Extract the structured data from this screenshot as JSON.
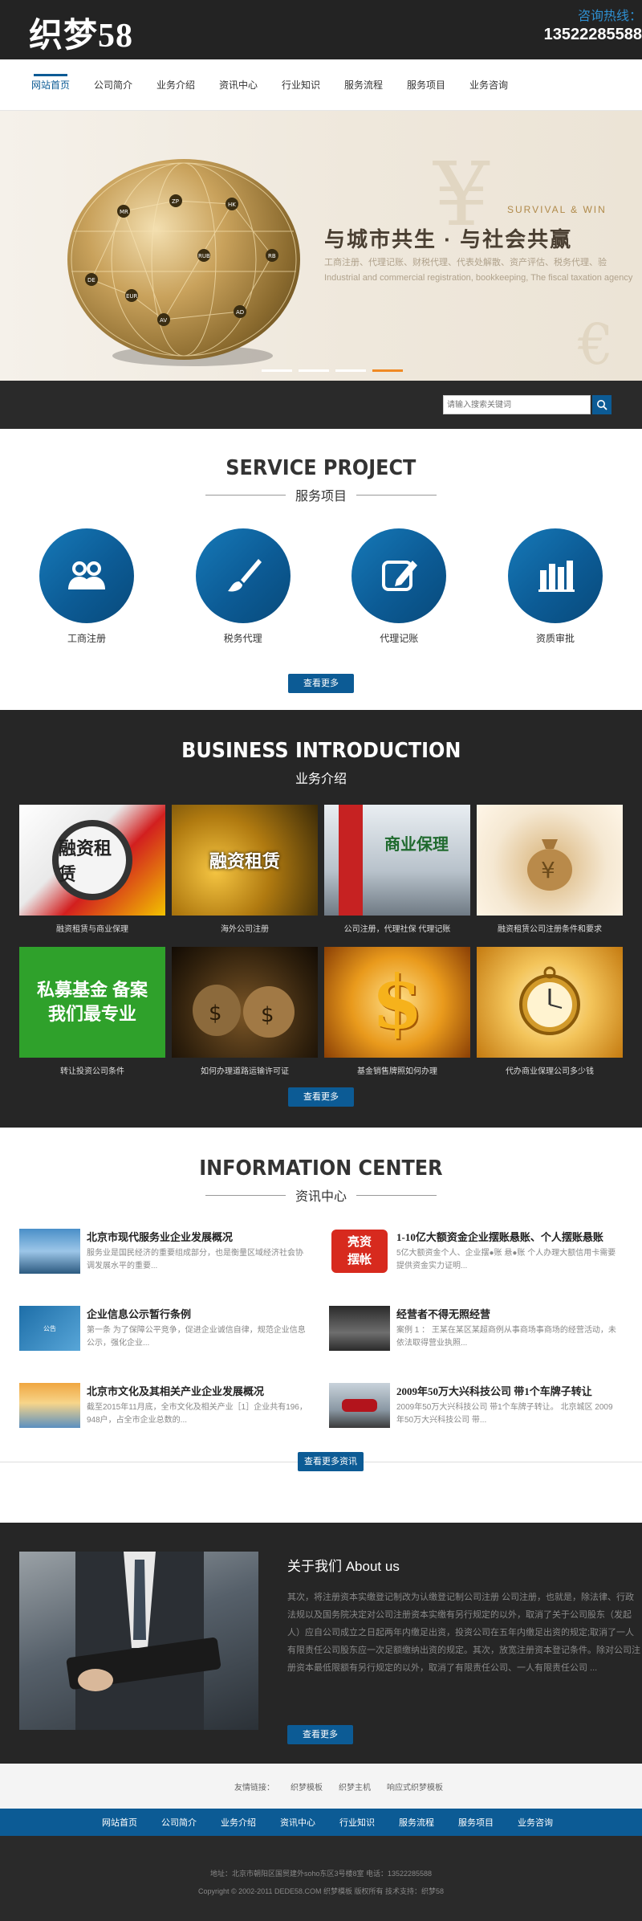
{
  "header": {
    "logo": "织梦58",
    "hotline_label": "咨询热线：",
    "hotline_number": "13522285588"
  },
  "nav": {
    "items": [
      "网站首页",
      "公司简介",
      "业务介绍",
      "资讯中心",
      "行业知识",
      "服务流程",
      "服务项目",
      "业务咨询"
    ]
  },
  "banner": {
    "tag": "SURVIVAL & WIN",
    "headline": "与城市共生 · 与社会共赢",
    "sub1": "工商注册、代理记账、财税代理、代表处解散、资产评估、税务代理、验",
    "sub2": "Industrial and commercial registration, bookkeeping, The fiscal taxation agency",
    "globe_labels": [
      "HK",
      "RB",
      "AD",
      "DE",
      "MR",
      "ZP",
      "AV",
      "EUR",
      "RUB"
    ]
  },
  "search": {
    "placeholder": "请输入搜索关键词"
  },
  "service": {
    "title_en": "SERVICE PROJECT",
    "title_cn": "服务项目",
    "items": [
      {
        "label": "工商注册",
        "icon": "people-icon"
      },
      {
        "label": "税务代理",
        "icon": "brush-icon"
      },
      {
        "label": "代理记账",
        "icon": "edit-icon"
      },
      {
        "label": "资质审批",
        "icon": "chart-icon"
      }
    ],
    "more": "查看更多"
  },
  "business": {
    "title_en": "BUSINESS INTRODUCTION",
    "title_cn": "业务介绍",
    "items": [
      {
        "caption": "融资租赁与商业保理",
        "img_text": "融资租赁"
      },
      {
        "caption": "海外公司注册",
        "img_text": "融资租赁"
      },
      {
        "caption": "公司注册，代理社保 代理记账",
        "img_text": "商业保理"
      },
      {
        "caption": "融资租赁公司注册条件和要求",
        "img_text": ""
      },
      {
        "caption": "转让投资公司条件",
        "img_text": "私募基金 备案 我们最专业"
      },
      {
        "caption": "如何办理道路运输许可证",
        "img_text": ""
      },
      {
        "caption": "基金销售牌照如何办理",
        "img_text": ""
      },
      {
        "caption": "代办商业保理公司多少钱",
        "img_text": ""
      }
    ],
    "more": "查看更多"
  },
  "info": {
    "title_en": "INFORMATION CENTER",
    "title_cn": "资讯中心",
    "items": [
      {
        "title": "北京市现代服务业企业发展概况",
        "desc": "服务业是国民经济的重要组成部分，也是衡量区域经济社会协调发展水平的重要..."
      },
      {
        "title": "1-10亿大额资金企业摆账悬账、个人摆账悬账",
        "desc": "5亿大额资金个人、企业摆●账 悬●账 个人办理大额信用卡需要提供资金实力证明..."
      },
      {
        "title": "企业信息公示暂行条例",
        "desc": "第一条 为了保障公平竞争，促进企业诚信自律，规范企业信息公示，强化企业..."
      },
      {
        "title": "经营者不得无照经营",
        "desc": "案例 1 ： 王某在某区某超商例从事商场事商场的经营活动，未依法取得营业执照..."
      },
      {
        "title": "北京市文化及其相关产业企业发展概况",
        "desc": "截至2015年11月底，全市文化及相关产业［1］企业共有196，948户，占全市企业总数的..."
      },
      {
        "title": "2009年50万大兴科技公司 带1个车牌子转让",
        "desc": "2009年50万大兴科技公司 带1个车牌子转让。 北京城区 2009年50万大兴科技公司 带..."
      }
    ],
    "more": "查看更多资讯"
  },
  "about": {
    "title": "关于我们   About us",
    "text": "其次，将注册资本实缴登记制改为认缴登记制公司注册 公司注册，也就是，除法律、行政法规以及国务院决定对公司注册资本实缴有另行规定的以外，取消了关于公司股东（发起人）应自公司成立之日起两年内缴足出资，投资公司在五年内缴足出资的规定;取消了一人有限责任公司股东应一次足额缴纳出资的规定。其次，放宽注册资本登记条件。除对公司注册资本最低限额有另行规定的以外，取消了有限责任公司、一人有限责任公司 ...",
    "more": "查看更多"
  },
  "links": {
    "label": "友情链接：",
    "items": [
      "织梦模板",
      "织梦主机",
      "响应式织梦模板"
    ]
  },
  "bottom_nav": {
    "items": [
      "网站首页",
      "公司简介",
      "业务介绍",
      "资讯中心",
      "行业知识",
      "服务流程",
      "服务项目",
      "业务咨询"
    ]
  },
  "footer": {
    "line1": "地址：北京市朝阳区国贸建外soho东区3号楼8室          电话：13522285588",
    "line2": "Copyright © 2002-2011 DEDE58.COM 织梦模板 版权所有 技术支持：织梦58"
  },
  "colors": {
    "brand_blue": "#0c5b95",
    "dark": "#262626",
    "accent_orange": "#f08a24"
  }
}
